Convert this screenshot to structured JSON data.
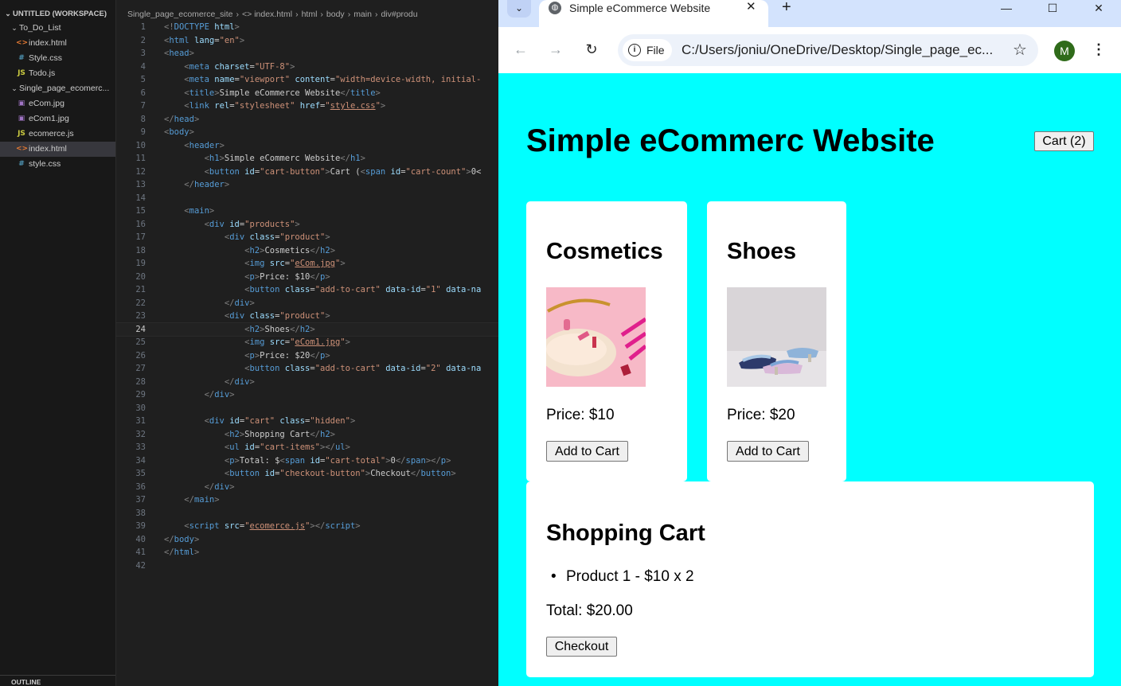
{
  "explorer": {
    "workspace": "UNTITLED (WORKSPACE)",
    "folder1": "To_Do_List",
    "folder1_files": [
      {
        "name": "index.html",
        "icon": "<>",
        "color": "#e37933"
      },
      {
        "name": "Style.css",
        "icon": "#",
        "color": "#519aba"
      },
      {
        "name": "Todo.js",
        "icon": "JS",
        "color": "#cbcb41"
      }
    ],
    "folder2": "Single_page_ecomerc...",
    "folder2_files": [
      {
        "name": "eCom.jpg",
        "icon": "▣",
        "color": "#a074c4"
      },
      {
        "name": "eCom1.jpg",
        "icon": "▣",
        "color": "#a074c4"
      },
      {
        "name": "ecomerce.js",
        "icon": "JS",
        "color": "#cbcb41"
      },
      {
        "name": "index.html",
        "icon": "<>",
        "color": "#e37933"
      },
      {
        "name": "style.css",
        "icon": "#",
        "color": "#519aba"
      }
    ],
    "outline": "OUTLINE"
  },
  "breadcrumbs": [
    "Single_page_ecomerce_site",
    "›",
    "<> index.html",
    "›",
    "html",
    "›",
    "body",
    "›",
    "main",
    "›",
    "div#produ"
  ],
  "code": [
    [
      [
        "p",
        "<!"
      ],
      [
        "t",
        "DOCTYPE"
      ],
      [
        "a",
        " html"
      ],
      [
        "p",
        ">"
      ]
    ],
    [
      [
        "p",
        "<"
      ],
      [
        "t",
        "html"
      ],
      [
        "a",
        " lang"
      ],
      [
        "c",
        "="
      ],
      [
        "v",
        "\"en\""
      ],
      [
        "p",
        ">"
      ]
    ],
    [
      [
        "p",
        "<"
      ],
      [
        "t",
        "head"
      ],
      [
        "p",
        ">"
      ]
    ],
    [
      [
        "c",
        "    "
      ],
      [
        "p",
        "<"
      ],
      [
        "t",
        "meta"
      ],
      [
        "a",
        " charset"
      ],
      [
        "c",
        "="
      ],
      [
        "v",
        "\"UTF-8\""
      ],
      [
        "p",
        ">"
      ]
    ],
    [
      [
        "c",
        "    "
      ],
      [
        "p",
        "<"
      ],
      [
        "t",
        "meta"
      ],
      [
        "a",
        " name"
      ],
      [
        "c",
        "="
      ],
      [
        "v",
        "\"viewport\""
      ],
      [
        "a",
        " content"
      ],
      [
        "c",
        "="
      ],
      [
        "v",
        "\"width=device-width, initial-"
      ]
    ],
    [
      [
        "c",
        "    "
      ],
      [
        "p",
        "<"
      ],
      [
        "t",
        "title"
      ],
      [
        "p",
        ">"
      ],
      [
        "c",
        "Simple eCommerce Website"
      ],
      [
        "p",
        "</"
      ],
      [
        "t",
        "title"
      ],
      [
        "p",
        ">"
      ]
    ],
    [
      [
        "c",
        "    "
      ],
      [
        "p",
        "<"
      ],
      [
        "t",
        "link"
      ],
      [
        "a",
        " rel"
      ],
      [
        "c",
        "="
      ],
      [
        "v",
        "\"stylesheet\""
      ],
      [
        "a",
        " href"
      ],
      [
        "c",
        "="
      ],
      [
        "v",
        "\""
      ],
      [
        "u",
        "style.css"
      ],
      [
        "v",
        "\""
      ],
      [
        "p",
        ">"
      ]
    ],
    [
      [
        "p",
        "</"
      ],
      [
        "t",
        "head"
      ],
      [
        "p",
        ">"
      ]
    ],
    [
      [
        "p",
        "<"
      ],
      [
        "t",
        "body"
      ],
      [
        "p",
        ">"
      ]
    ],
    [
      [
        "c",
        "    "
      ],
      [
        "p",
        "<"
      ],
      [
        "t",
        "header"
      ],
      [
        "p",
        ">"
      ]
    ],
    [
      [
        "c",
        "        "
      ],
      [
        "p",
        "<"
      ],
      [
        "t",
        "h1"
      ],
      [
        "p",
        ">"
      ],
      [
        "c",
        "Simple eCommerc Website"
      ],
      [
        "p",
        "</"
      ],
      [
        "t",
        "h1"
      ],
      [
        "p",
        ">"
      ]
    ],
    [
      [
        "c",
        "        "
      ],
      [
        "p",
        "<"
      ],
      [
        "t",
        "button"
      ],
      [
        "a",
        " id"
      ],
      [
        "c",
        "="
      ],
      [
        "v",
        "\"cart-button\""
      ],
      [
        "p",
        ">"
      ],
      [
        "c",
        "Cart ("
      ],
      [
        "p",
        "<"
      ],
      [
        "t",
        "span"
      ],
      [
        "a",
        " id"
      ],
      [
        "c",
        "="
      ],
      [
        "v",
        "\"cart-count\""
      ],
      [
        "p",
        ">"
      ],
      [
        "c",
        "0<"
      ]
    ],
    [
      [
        "c",
        "    "
      ],
      [
        "p",
        "</"
      ],
      [
        "t",
        "header"
      ],
      [
        "p",
        ">"
      ]
    ],
    [],
    [
      [
        "c",
        "    "
      ],
      [
        "p",
        "<"
      ],
      [
        "t",
        "main"
      ],
      [
        "p",
        ">"
      ]
    ],
    [
      [
        "c",
        "        "
      ],
      [
        "p",
        "<"
      ],
      [
        "t",
        "div"
      ],
      [
        "a",
        " id"
      ],
      [
        "c",
        "="
      ],
      [
        "v",
        "\"products\""
      ],
      [
        "p",
        ">"
      ]
    ],
    [
      [
        "c",
        "            "
      ],
      [
        "p",
        "<"
      ],
      [
        "t",
        "div"
      ],
      [
        "a",
        " class"
      ],
      [
        "c",
        "="
      ],
      [
        "v",
        "\"product\""
      ],
      [
        "p",
        ">"
      ]
    ],
    [
      [
        "c",
        "                "
      ],
      [
        "p",
        "<"
      ],
      [
        "t",
        "h2"
      ],
      [
        "p",
        ">"
      ],
      [
        "c",
        "Cosmetics"
      ],
      [
        "p",
        "</"
      ],
      [
        "t",
        "h2"
      ],
      [
        "p",
        ">"
      ]
    ],
    [
      [
        "c",
        "                "
      ],
      [
        "p",
        "<"
      ],
      [
        "t",
        "img"
      ],
      [
        "a",
        " src"
      ],
      [
        "c",
        "="
      ],
      [
        "v",
        "\""
      ],
      [
        "u",
        "eCom.jpg"
      ],
      [
        "v",
        "\""
      ],
      [
        "p",
        ">"
      ]
    ],
    [
      [
        "c",
        "                "
      ],
      [
        "p",
        "<"
      ],
      [
        "t",
        "p"
      ],
      [
        "p",
        ">"
      ],
      [
        "c",
        "Price: $10"
      ],
      [
        "p",
        "</"
      ],
      [
        "t",
        "p"
      ],
      [
        "p",
        ">"
      ]
    ],
    [
      [
        "c",
        "                "
      ],
      [
        "p",
        "<"
      ],
      [
        "t",
        "button"
      ],
      [
        "a",
        " class"
      ],
      [
        "c",
        "="
      ],
      [
        "v",
        "\"add-to-cart\""
      ],
      [
        "a",
        " data-id"
      ],
      [
        "c",
        "="
      ],
      [
        "v",
        "\"1\""
      ],
      [
        "a",
        " data-na"
      ]
    ],
    [
      [
        "c",
        "            "
      ],
      [
        "p",
        "</"
      ],
      [
        "t",
        "div"
      ],
      [
        "p",
        ">"
      ]
    ],
    [
      [
        "c",
        "            "
      ],
      [
        "p",
        "<"
      ],
      [
        "t",
        "div"
      ],
      [
        "a",
        " class"
      ],
      [
        "c",
        "="
      ],
      [
        "v",
        "\"product\""
      ],
      [
        "p",
        ">"
      ]
    ],
    [
      [
        "c",
        "                "
      ],
      [
        "p",
        "<"
      ],
      [
        "t",
        "h2"
      ],
      [
        "p",
        ">"
      ],
      [
        "c",
        "Shoes"
      ],
      [
        "p",
        "</"
      ],
      [
        "t",
        "h2"
      ],
      [
        "p",
        ">"
      ]
    ],
    [
      [
        "c",
        "                "
      ],
      [
        "p",
        "<"
      ],
      [
        "t",
        "img"
      ],
      [
        "a",
        " src"
      ],
      [
        "c",
        "="
      ],
      [
        "v",
        "\""
      ],
      [
        "u",
        "eCom1.jpg"
      ],
      [
        "v",
        "\""
      ],
      [
        "p",
        ">"
      ]
    ],
    [
      [
        "c",
        "                "
      ],
      [
        "p",
        "<"
      ],
      [
        "t",
        "p"
      ],
      [
        "p",
        ">"
      ],
      [
        "c",
        "Price: $20"
      ],
      [
        "p",
        "</"
      ],
      [
        "t",
        "p"
      ],
      [
        "p",
        ">"
      ]
    ],
    [
      [
        "c",
        "                "
      ],
      [
        "p",
        "<"
      ],
      [
        "t",
        "button"
      ],
      [
        "a",
        " class"
      ],
      [
        "c",
        "="
      ],
      [
        "v",
        "\"add-to-cart\""
      ],
      [
        "a",
        " data-id"
      ],
      [
        "c",
        "="
      ],
      [
        "v",
        "\"2\""
      ],
      [
        "a",
        " data-na"
      ]
    ],
    [
      [
        "c",
        "            "
      ],
      [
        "p",
        "</"
      ],
      [
        "t",
        "div"
      ],
      [
        "p",
        ">"
      ]
    ],
    [
      [
        "c",
        "        "
      ],
      [
        "p",
        "</"
      ],
      [
        "t",
        "div"
      ],
      [
        "p",
        ">"
      ]
    ],
    [],
    [
      [
        "c",
        "        "
      ],
      [
        "p",
        "<"
      ],
      [
        "t",
        "div"
      ],
      [
        "a",
        " id"
      ],
      [
        "c",
        "="
      ],
      [
        "v",
        "\"cart\""
      ],
      [
        "a",
        " class"
      ],
      [
        "c",
        "="
      ],
      [
        "v",
        "\"hidden\""
      ],
      [
        "p",
        ">"
      ]
    ],
    [
      [
        "c",
        "            "
      ],
      [
        "p",
        "<"
      ],
      [
        "t",
        "h2"
      ],
      [
        "p",
        ">"
      ],
      [
        "c",
        "Shopping Cart"
      ],
      [
        "p",
        "</"
      ],
      [
        "t",
        "h2"
      ],
      [
        "p",
        ">"
      ]
    ],
    [
      [
        "c",
        "            "
      ],
      [
        "p",
        "<"
      ],
      [
        "t",
        "ul"
      ],
      [
        "a",
        " id"
      ],
      [
        "c",
        "="
      ],
      [
        "v",
        "\"cart-items\""
      ],
      [
        "p",
        "></"
      ],
      [
        "t",
        "ul"
      ],
      [
        "p",
        ">"
      ]
    ],
    [
      [
        "c",
        "            "
      ],
      [
        "p",
        "<"
      ],
      [
        "t",
        "p"
      ],
      [
        "p",
        ">"
      ],
      [
        "c",
        "Total: $"
      ],
      [
        "p",
        "<"
      ],
      [
        "t",
        "span"
      ],
      [
        "a",
        " id"
      ],
      [
        "c",
        "="
      ],
      [
        "v",
        "\"cart-total\""
      ],
      [
        "p",
        ">"
      ],
      [
        "c",
        "0"
      ],
      [
        "p",
        "</"
      ],
      [
        "t",
        "span"
      ],
      [
        "p",
        "></"
      ],
      [
        "t",
        "p"
      ],
      [
        "p",
        ">"
      ]
    ],
    [
      [
        "c",
        "            "
      ],
      [
        "p",
        "<"
      ],
      [
        "t",
        "button"
      ],
      [
        "a",
        " id"
      ],
      [
        "c",
        "="
      ],
      [
        "v",
        "\"checkout-button\""
      ],
      [
        "p",
        ">"
      ],
      [
        "c",
        "Checkout"
      ],
      [
        "p",
        "</"
      ],
      [
        "t",
        "button"
      ],
      [
        "p",
        ">"
      ]
    ],
    [
      [
        "c",
        "        "
      ],
      [
        "p",
        "</"
      ],
      [
        "t",
        "div"
      ],
      [
        "p",
        ">"
      ]
    ],
    [
      [
        "c",
        "    "
      ],
      [
        "p",
        "</"
      ],
      [
        "t",
        "main"
      ],
      [
        "p",
        ">"
      ]
    ],
    [],
    [
      [
        "c",
        "    "
      ],
      [
        "p",
        "<"
      ],
      [
        "t",
        "script"
      ],
      [
        "a",
        " src"
      ],
      [
        "c",
        "="
      ],
      [
        "v",
        "\""
      ],
      [
        "u",
        "ecomerce.js"
      ],
      [
        "v",
        "\""
      ],
      [
        "p",
        "></"
      ],
      [
        "t",
        "script"
      ],
      [
        "p",
        ">"
      ]
    ],
    [
      [
        "p",
        "</"
      ],
      [
        "t",
        "body"
      ],
      [
        "p",
        ">"
      ]
    ],
    [
      [
        "p",
        "</"
      ],
      [
        "t",
        "html"
      ],
      [
        "p",
        ">"
      ]
    ],
    []
  ],
  "current_line": 24,
  "browser": {
    "tab_menu_icon": "chevron-down-icon",
    "tab_title": "Simple eCommerce Website",
    "tab_close": "✕",
    "new_tab": "+",
    "win_min": "—",
    "win_max": "☐",
    "win_close": "✕",
    "back": "←",
    "forward": "→",
    "reload": "↻",
    "chip_icon": "i",
    "chip_label": "File",
    "url": "C:/Users/joniu/OneDrive/Desktop/Single_page_ec...",
    "star": "☆",
    "avatar": "M",
    "menu": "⋮"
  },
  "site": {
    "title": "Simple eCommerc Website",
    "cart_button": "Cart (2)",
    "products": [
      {
        "name": "Cosmetics",
        "price": "Price: $10",
        "button": "Add to Cart"
      },
      {
        "name": "Shoes",
        "price": "Price: $20",
        "button": "Add to Cart"
      }
    ],
    "cart": {
      "heading": "Shopping Cart",
      "items": [
        "Product 1 - $10 x 2"
      ],
      "total": "Total: $20.00",
      "checkout": "Checkout"
    }
  }
}
